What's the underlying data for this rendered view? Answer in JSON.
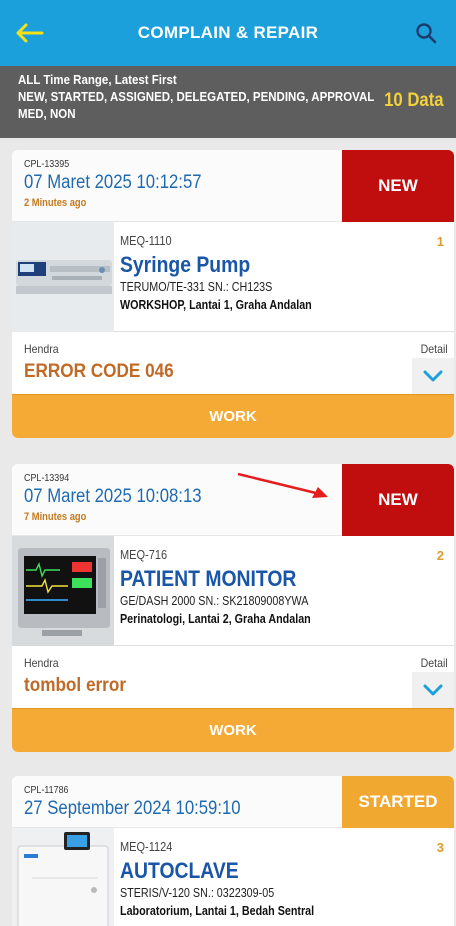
{
  "header": {
    "title": "COMPLAIN & REPAIR",
    "back_icon": "arrow-left-icon",
    "search_icon": "search-icon"
  },
  "filter": {
    "line1": "ALL Time Range, Latest First",
    "line2": "NEW, STARTED, ASSIGNED, DELEGATED, PENDING, APPROVAL",
    "line3": "MED, NON",
    "count": "10 Data"
  },
  "colors": {
    "header_bg": "#1ca0dc",
    "new_status": "#c00d0d",
    "started_status": "#f0a830",
    "work_button": "#f4aa34",
    "equipment_name": "#1a56a8"
  },
  "tickets": [
    {
      "id": "CPL-13395",
      "date": "07 Maret 2025 10:12:57",
      "ago": "2 Minutes ago",
      "status": "NEW",
      "equipment_code": "MEQ-1110",
      "number": "1",
      "equipment_name": "Syringe Pump",
      "model": "TERUMO/TE-331  SN.: CH123S",
      "location": "WORKSHOP, Lantai 1, Graha Andalan",
      "reporter": "Hendra",
      "problem": "ERROR CODE 046",
      "detail_label": "Detail",
      "action": "WORK"
    },
    {
      "id": "CPL-13394",
      "date": "07 Maret 2025 10:08:13",
      "ago": "7 Minutes ago",
      "status": "NEW",
      "equipment_code": "MEQ-716",
      "number": "2",
      "equipment_name": "PATIENT MONITOR",
      "model": "GE/DASH 2000  SN.: SK21809008YWA",
      "location": "Perinatologi, Lantai 2, Graha Andalan",
      "reporter": "Hendra",
      "problem": "tombol error",
      "detail_label": "Detail",
      "action": "WORK"
    },
    {
      "id": "CPL-11786",
      "date": "27 September 2024 10:59:10",
      "status": "STARTED",
      "equipment_code": "MEQ-1124",
      "number": "3",
      "equipment_name": "AUTOCLAVE",
      "model": "STERIS/V-120  SN.: 0322309-05",
      "location": "Laboratorium, Lantai 1, Bedah Sentral"
    }
  ]
}
